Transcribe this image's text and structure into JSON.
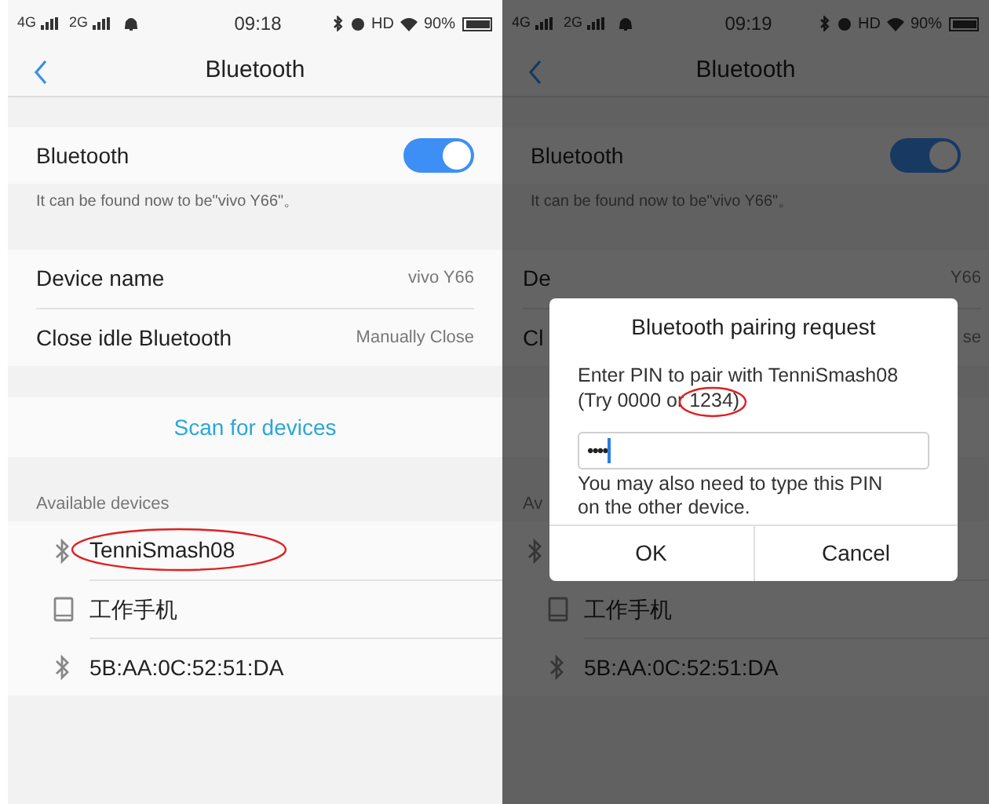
{
  "screens": [
    {
      "status": {
        "network": "4G",
        "network2": "2G",
        "time": "09:18",
        "hd": "HD",
        "battery": "90%"
      },
      "title": "Bluetooth",
      "bluetooth": {
        "label": "Bluetooth",
        "on": true
      },
      "caption": "It can be found now to be\"vivo Y66\"。",
      "settings": [
        {
          "label": "Device name",
          "value": "vivo Y66"
        },
        {
          "label": "Close idle Bluetooth",
          "value": "Manually Close"
        }
      ],
      "scan": "Scan for devices",
      "section": "Available devices",
      "devices": [
        {
          "kind": "bluetooth",
          "name": "TenniSmash08",
          "circled": true
        },
        {
          "kind": "device",
          "name": "工作手机",
          "circled": false
        },
        {
          "kind": "bluetooth",
          "name": "5B:AA:0C:52:51:DA",
          "circled": false
        }
      ]
    },
    {
      "status": {
        "network": "4G",
        "network2": "2G",
        "time": "09:19",
        "hd": "HD",
        "battery": "90%"
      },
      "title": "Bluetooth",
      "bluetooth": {
        "label": "Bluetooth",
        "on": true
      },
      "caption": "It can be found now to be\"vivo Y66\"。",
      "settings": [
        {
          "label": "De",
          "value": "Y66"
        },
        {
          "label": "Cl",
          "value": "se"
        }
      ],
      "section": "Av",
      "devices": [
        {
          "kind": "bluetooth",
          "circled": false
        },
        {
          "kind": "device",
          "name": "工作手机",
          "circled": false
        },
        {
          "kind": "bluetooth",
          "name": "5B:AA:0C:52:51:DA",
          "circled": false
        }
      ],
      "dialog": {
        "title": "Bluetooth pairing request",
        "message": [
          "Enter PIN to pair with TenniSmash08",
          "(Try 0000 or 1234)"
        ],
        "circled": true,
        "pin": "••••",
        "hint": [
          "You may also need to type this PIN",
          "on the other device."
        ],
        "buttons": [
          "OK",
          "Cancel"
        ]
      }
    }
  ]
}
